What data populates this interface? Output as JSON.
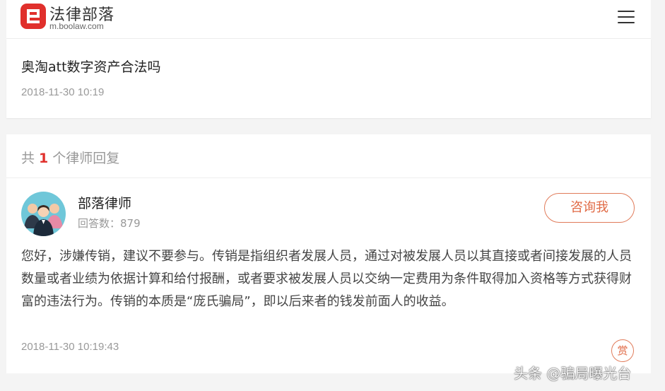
{
  "header": {
    "brand_name": "法律部落",
    "brand_url": "m.boolaw.com",
    "brand_color": "#e0302c",
    "logo_icon": "boolaw-logo-icon",
    "menu_icon": "hamburger-menu-icon"
  },
  "question": {
    "title": "奥淘att数字资产合法吗",
    "time": "2018-11-30 10:19"
  },
  "answers": {
    "count_prefix": "共",
    "count": "1",
    "count_suffix": "个律师回复",
    "items": [
      {
        "lawyer_name": "部落律师",
        "stat_label": "回答数：",
        "stat_value": "879",
        "consult_label": "咨询我",
        "body": "您好，涉嫌传销，建议不要参与。传销是指组织者发展人员，通过对被发展人员以其直接或者间接发展的人员数量或者业绩为依据计算和给付报酬，或者要求被发展人员以交纳一定费用为条件取得加入资格等方式获得财富的违法行为。传销的本质是“庞氏骗局”，即以后来者的钱发前面人的收益。",
        "time": "2018-11-30 10:19:43",
        "reward_label": "赏"
      }
    ]
  },
  "watermark": "头条 @骗局曝光台",
  "accent_color": "#e06a45"
}
